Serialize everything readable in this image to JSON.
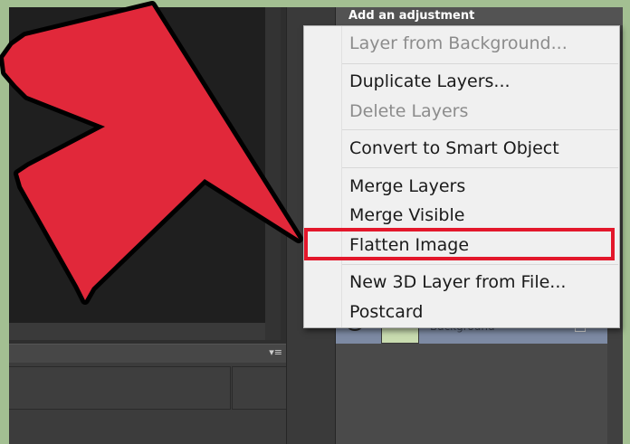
{
  "panel": {
    "heading": "Add an adjustment",
    "layer_name": "Background"
  },
  "menu": {
    "items": [
      {
        "label": "Layer from Background...",
        "enabled": false
      },
      {
        "label": "Duplicate Layers...",
        "enabled": true
      },
      {
        "label": "Delete Layers",
        "enabled": false
      },
      {
        "label": "Convert to Smart Object",
        "enabled": true
      },
      {
        "label": "Merge Layers",
        "enabled": true
      },
      {
        "label": "Merge Visible",
        "enabled": true
      },
      {
        "label": "Flatten Image",
        "enabled": true,
        "highlighted": true
      },
      {
        "label": "New 3D Layer from File...",
        "enabled": true
      },
      {
        "label": "Postcard",
        "enabled": true
      }
    ]
  },
  "colors": {
    "arrow_fill": "#e1283a",
    "highlight_border": "#e3172b",
    "page_background": "#a3bf92"
  },
  "icons": {
    "panel_menu": "panel-menu-icon",
    "pointer_arrow": "pointer-arrow-icon"
  }
}
